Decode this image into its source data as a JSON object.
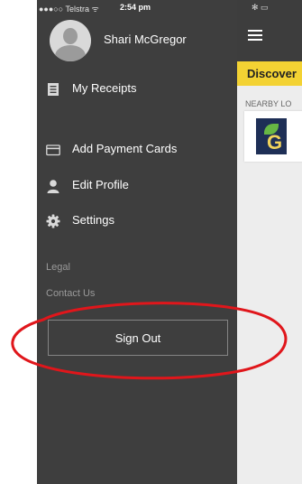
{
  "status_bar": {
    "carrier": "●●●○○ Telstra ᯤ",
    "time": "2:54 pm",
    "right_icons": "✻ ▭"
  },
  "drawer": {
    "username": "Shari McGregor",
    "menu": [
      {
        "label": "My Receipts",
        "icon": "receipt-icon"
      },
      {
        "label": "Add Payment Cards",
        "icon": "credit-card-icon"
      },
      {
        "label": "Edit Profile",
        "icon": "person-icon"
      },
      {
        "label": "Settings",
        "icon": "gear-icon"
      }
    ],
    "links": [
      "Legal",
      "Contact Us"
    ],
    "sign_out": "Sign Out"
  },
  "app": {
    "tab": "Discover",
    "section_label": "NEARBY LO",
    "logo_letter": "G"
  },
  "colors": {
    "drawer_bg": "#3e3e3e",
    "tab_bar": "#f3d233",
    "annotation": "#e0161b"
  }
}
